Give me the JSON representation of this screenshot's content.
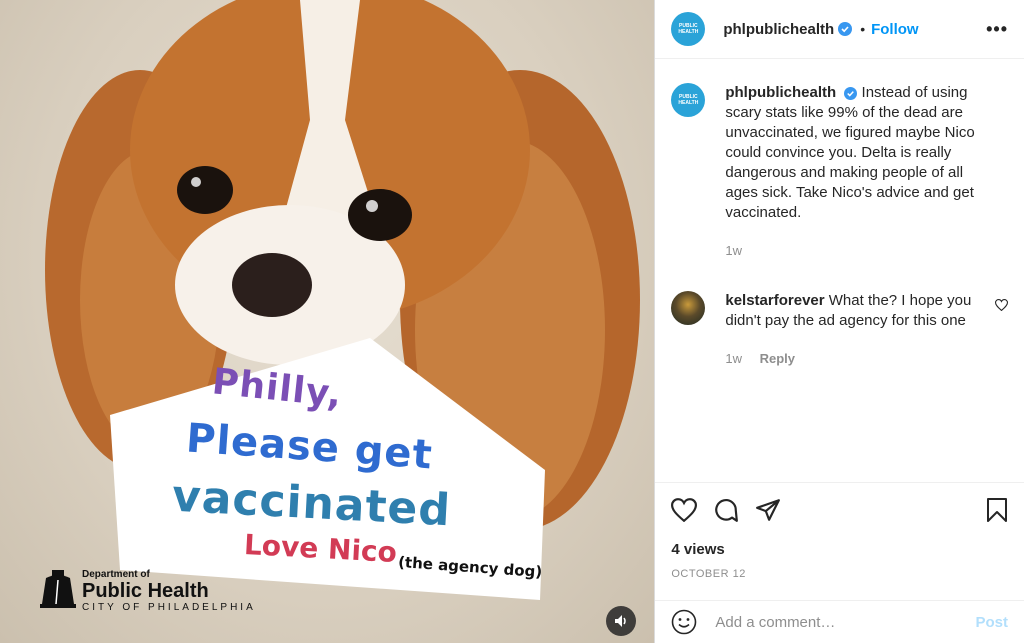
{
  "account": {
    "username": "phlpublichealth",
    "avatar_text": "PUBLIC HEALTH",
    "follow_label": "Follow",
    "separator": "•"
  },
  "media": {
    "sign_line1": "Philly,",
    "sign_line2": "Please get",
    "sign_line3": "vaccinated",
    "sign_line4": "Love Nico",
    "sign_line5": "(the agency dog)",
    "logo_dept": "Department of",
    "logo_name": "Public Health",
    "logo_city": "CITY OF PHILADELPHIA"
  },
  "caption": {
    "username": "phlpublichealth",
    "text": "Instead of using scary stats like 99% of the dead are unvaccinated, we figured maybe Nico could convince you. Delta is really dangerous and making people of all ages sick. Take Nico's advice and get vaccinated.",
    "time": "1w"
  },
  "comments": [
    {
      "username": "kelstarforever",
      "text": "What the? I hope you didn't pay the ad agency for this one",
      "time": "1w",
      "reply_label": "Reply"
    }
  ],
  "stats": {
    "views": "4 views",
    "date": "OCTOBER 12"
  },
  "add_comment": {
    "placeholder": "Add a comment…",
    "post_label": "Post"
  },
  "icons": [
    "verified-badge-icon",
    "more-options-icon",
    "heart-icon",
    "comment-icon",
    "share-icon",
    "bookmark-icon",
    "emoji-icon",
    "sound-icon"
  ],
  "colors": {
    "accent": "#0095f6",
    "avatar_bg": "#2aa3d8",
    "muted": "#8e8e8e",
    "post_disabled": "#b2dffc"
  }
}
